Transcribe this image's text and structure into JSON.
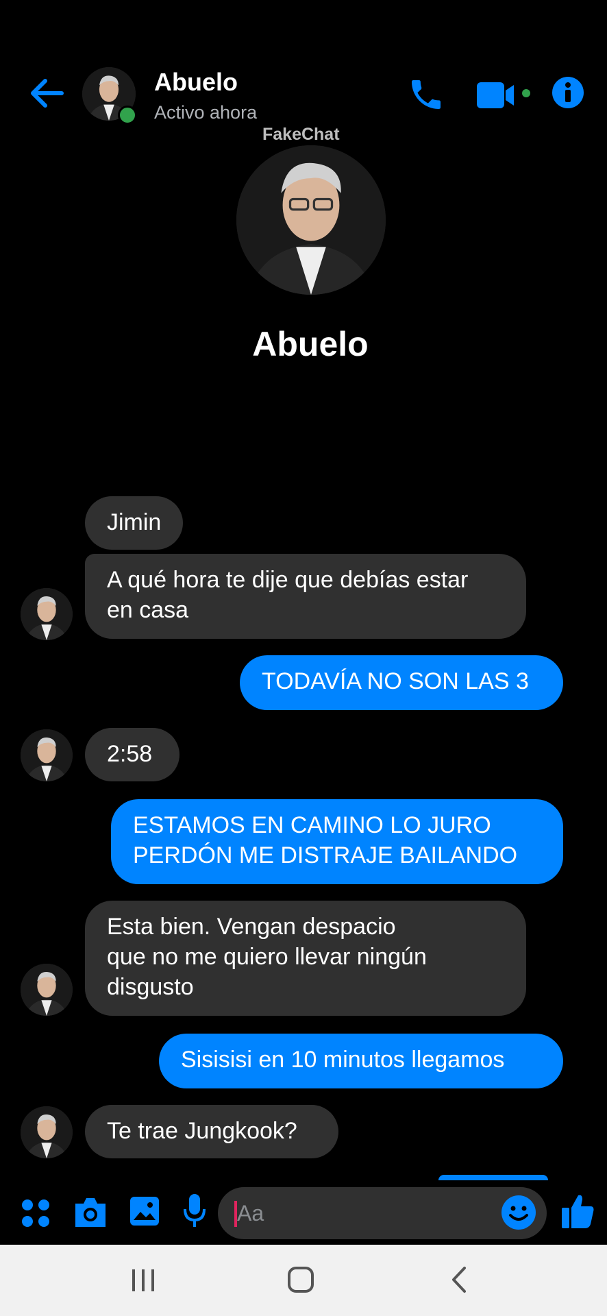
{
  "header": {
    "contact_name": "Abuelo",
    "status": "Activo ahora",
    "icons": [
      "back-arrow-icon",
      "phone-icon",
      "video-camera-icon",
      "info-icon"
    ],
    "accent_color": "#0084ff",
    "online_color": "#31a24c"
  },
  "watermark": "FakeChat",
  "profile": {
    "name": "Abuelo"
  },
  "messages": [
    {
      "from": "contact",
      "lines": [
        "Jimin"
      ]
    },
    {
      "from": "contact",
      "lines": [
        "A qué hora te dije que debías estar",
        "en casa"
      ]
    },
    {
      "from": "me",
      "lines": [
        "TODAVÍA NO SON LAS 3"
      ]
    },
    {
      "from": "contact",
      "lines": [
        "2:58"
      ]
    },
    {
      "from": "me",
      "lines": [
        "ESTAMOS EN CAMINO LO JURO",
        "PERDÓN ME DISTRAJE BAILANDO"
      ]
    },
    {
      "from": "contact",
      "lines": [
        "Esta bien. Vengan despacio",
        "que no me quiero llevar ningún",
        "disgusto"
      ]
    },
    {
      "from": "me",
      "lines": [
        "Sisisisi en 10 minutos llegamos"
      ]
    },
    {
      "from": "contact",
      "lines": [
        "Te trae Jungkook?"
      ]
    }
  ],
  "composer": {
    "placeholder": "Aa",
    "icons": [
      "apps-grid-icon",
      "camera-icon",
      "gallery-icon",
      "microphone-icon",
      "emoji-icon",
      "thumbs-up-icon"
    ]
  },
  "navbar": {
    "icons": [
      "recent-apps-icon",
      "home-icon",
      "back-icon"
    ]
  }
}
